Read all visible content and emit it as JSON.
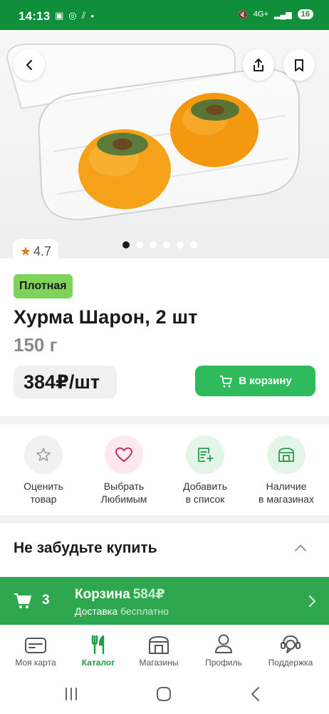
{
  "status_bar": {
    "time": "14:13",
    "battery": "16",
    "network": "4G+"
  },
  "hero": {
    "image_alt": "persimmon-product-photo",
    "slide_count": 6,
    "active_slide": 1
  },
  "rating": {
    "value": "4.7"
  },
  "product": {
    "badge": "Плотная",
    "title": "Хурма Шарон, 2 шт",
    "weight": "150 г",
    "price": "384₽/шт",
    "add_to_cart": "В корзину"
  },
  "actions": [
    {
      "line1": "Оценить",
      "line2": "товар",
      "icon": "star-icon",
      "bg": "#f1f1f1"
    },
    {
      "line1": "Выбрать",
      "line2": "Любимым",
      "icon": "heart-icon",
      "bg": "#fde8ee"
    },
    {
      "line1": "Добавить",
      "line2": "в список",
      "icon": "list-add-icon",
      "bg": "#e3f5e7"
    },
    {
      "line1": "Наличие",
      "line2": "в магазинах",
      "icon": "store-icon",
      "bg": "#e3f5e7"
    }
  ],
  "section": {
    "forget_title": "Не забудьте купить"
  },
  "cart_bar": {
    "count": "3",
    "title": "Корзина",
    "total": "584₽",
    "delivery_label": "Доставка",
    "delivery_value": "бесплатно"
  },
  "tabs": [
    {
      "label": "Моя карта",
      "icon": "card-icon"
    },
    {
      "label": "Каталог",
      "icon": "cutlery-icon"
    },
    {
      "label": "Магазины",
      "icon": "store-icon"
    },
    {
      "label": "Профиль",
      "icon": "profile-icon"
    },
    {
      "label": "Поддержка",
      "icon": "support-icon"
    }
  ],
  "colors": {
    "brand_green": "#2fba5c",
    "status_green": "#0f8f3a",
    "badge_green": "#7ed35a",
    "rating_orange": "#e07a10"
  }
}
